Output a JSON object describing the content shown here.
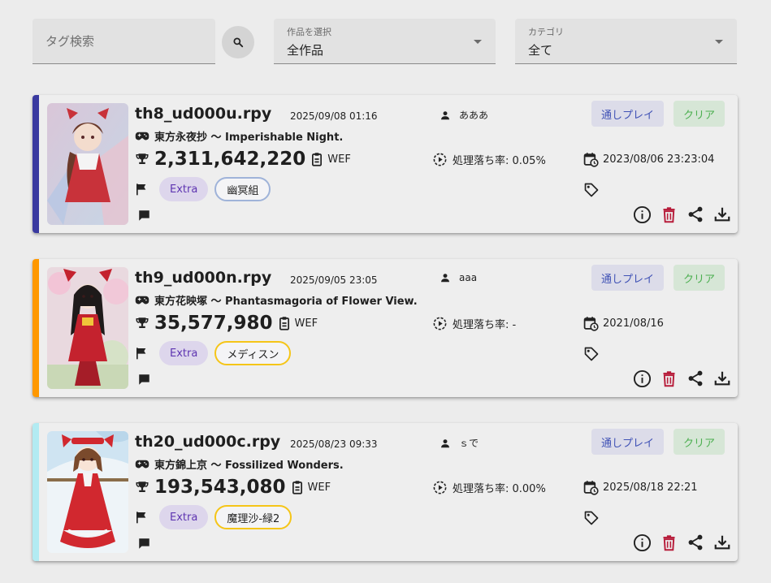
{
  "filters": {
    "tag_search_placeholder": "タグ検索",
    "work_label": "作品を選択",
    "work_value": "全作品",
    "category_label": "カテゴリ",
    "category_value": "全て"
  },
  "replays": [
    {
      "filename": "th8_ud000u.rpy",
      "uploaded": "2025/09/08 01:16",
      "user": "あああ",
      "game": "東方永夜抄 〜 Imperishable Night.",
      "score": "2,311,642,220",
      "shot": "WEF",
      "slowdown": "処理落ち率: 0.05%",
      "played": "2023/08/06 23:23:04",
      "difficulty": "Extra",
      "shot_type": "幽冥組",
      "run_label": "通しプレイ",
      "clear_label": "クリア",
      "accent_color": "#3a3aa0",
      "chip_border": "#9fb3d9"
    },
    {
      "filename": "th9_ud000n.rpy",
      "uploaded": "2025/09/05 23:05",
      "user": "aaa",
      "game": "東方花映塚 〜 Phantasmagoria of Flower View.",
      "score": "35,577,980",
      "shot": "WEF",
      "slowdown": "処理落ち率: -",
      "played": "2021/08/16",
      "difficulty": "Extra",
      "shot_type": "メディスン",
      "run_label": "通しプレイ",
      "clear_label": "クリア",
      "accent_color": "#ff9800",
      "chip_border": "#f5c518"
    },
    {
      "filename": "th20_ud000c.rpy",
      "uploaded": "2025/08/23 09:33",
      "user": "ｓで",
      "game": "東方錦上京 〜 Fossilized Wonders.",
      "score": "193,543,080",
      "shot": "WEF",
      "slowdown": "処理落ち率: 0.00%",
      "played": "2025/08/18 22:21",
      "difficulty": "Extra",
      "shot_type": "魔理沙-緑2",
      "run_label": "通しプレイ",
      "clear_label": "クリア",
      "accent_color": "#b2ebf2",
      "chip_border": "#f5c518"
    }
  ],
  "colors": {
    "run_bg": "#dcdce9",
    "clear_bg": "#d6e6d6",
    "delete_red": "#b71c3a"
  },
  "icons": [
    "search-icon",
    "person-icon",
    "gamepad-icon",
    "trophy-icon",
    "clipboard-icon",
    "slow-motion-icon",
    "calendar-icon",
    "flag-icon",
    "tag-icon",
    "comment-icon",
    "info-icon",
    "delete-icon",
    "share-icon",
    "download-icon"
  ]
}
